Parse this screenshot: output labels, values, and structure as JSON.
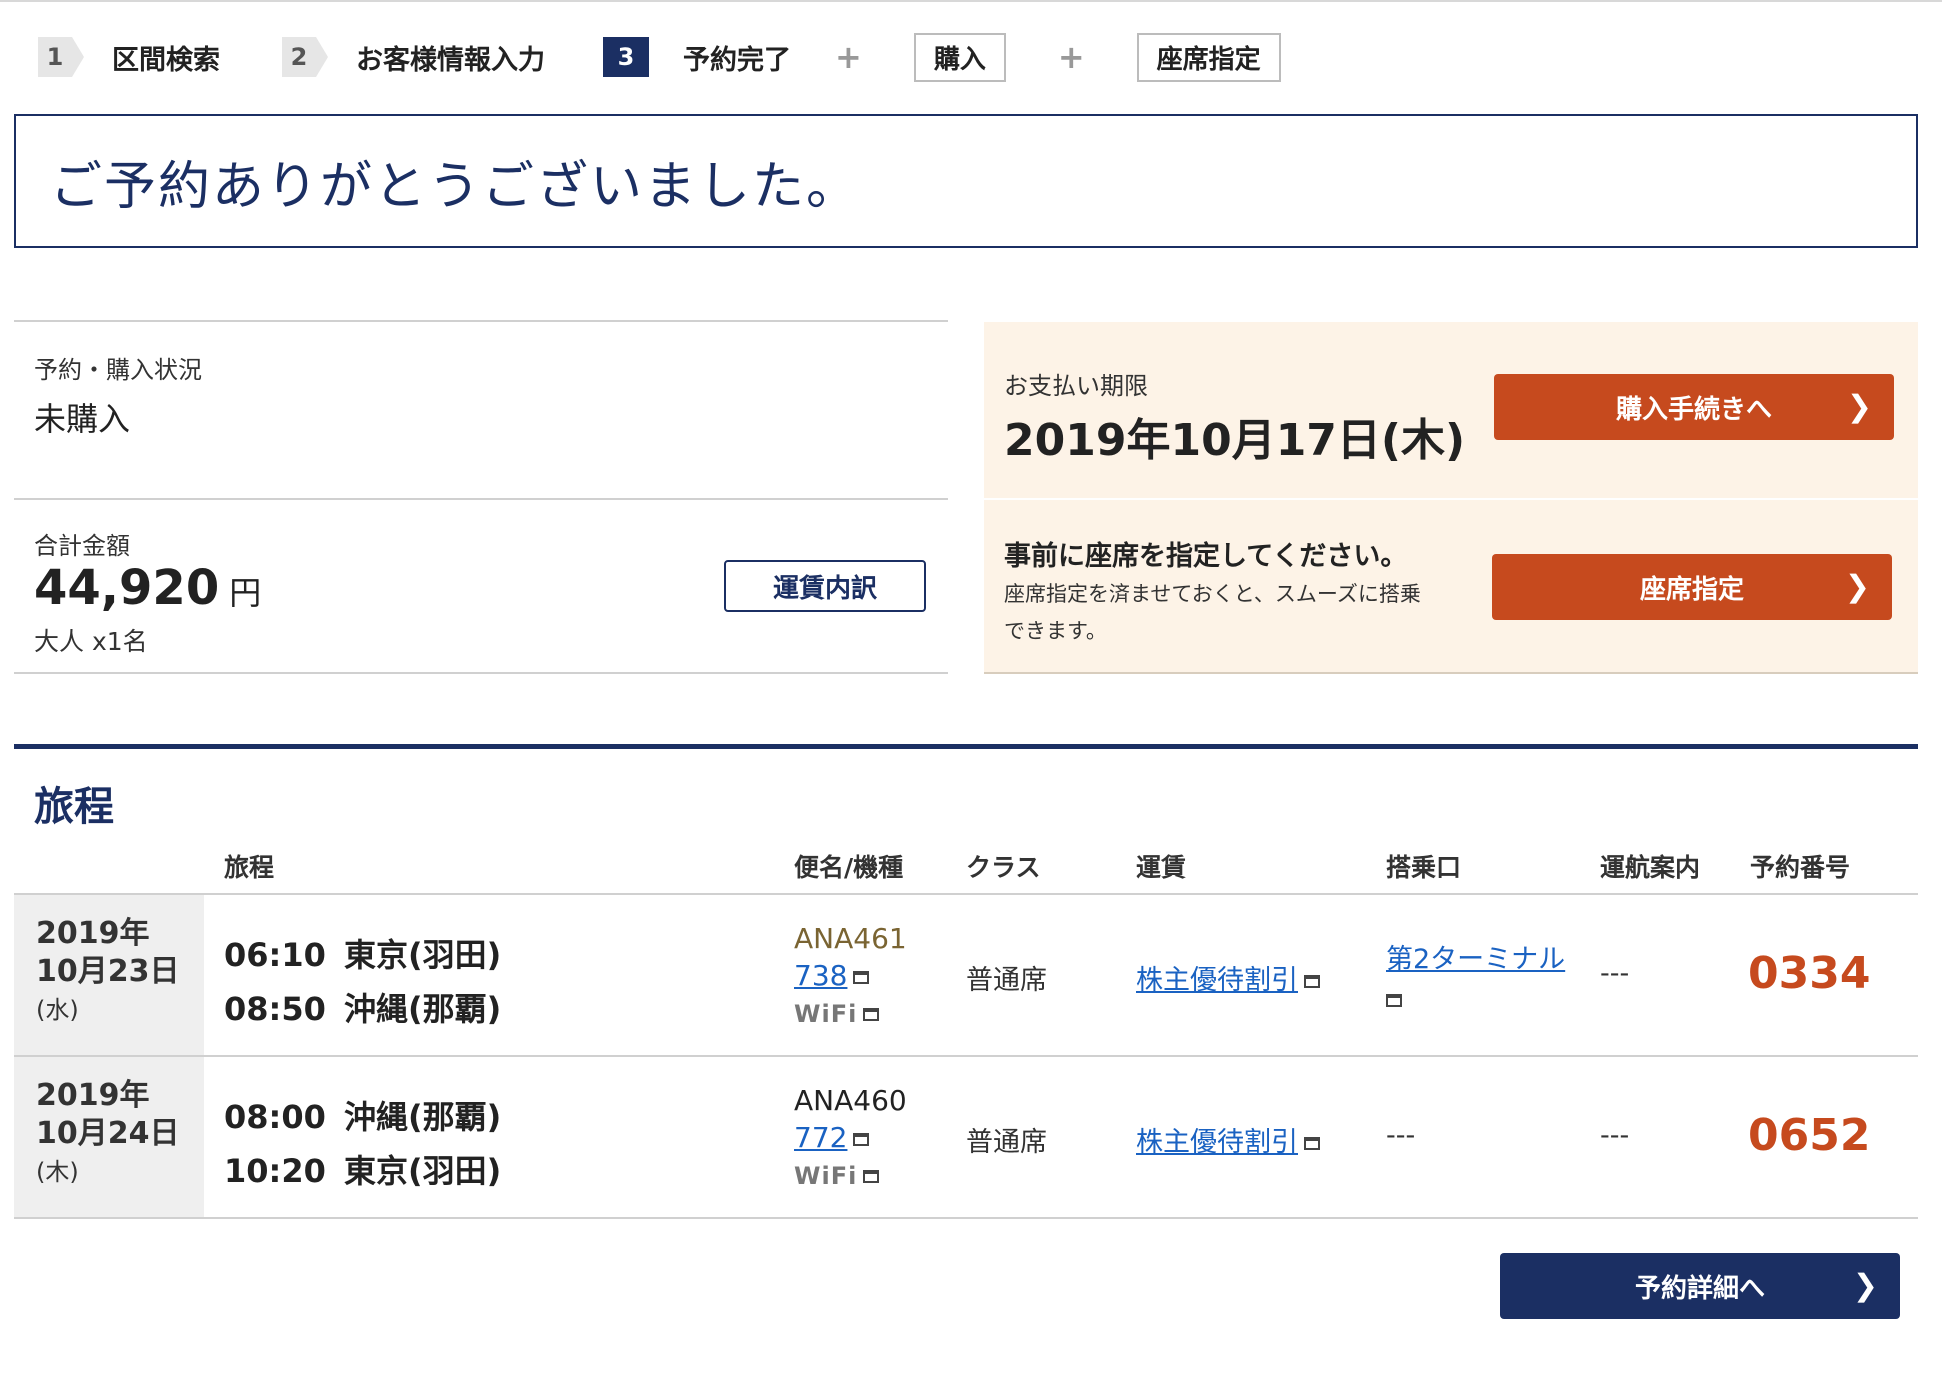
{
  "steps": [
    {
      "num": "1",
      "label": "区間検索"
    },
    {
      "num": "2",
      "label": "お客様情報入力"
    },
    {
      "num": "3",
      "label": "予約完了"
    }
  ],
  "plus": "+",
  "optional_steps": [
    "購入",
    "座席指定"
  ],
  "thanks": "ご予約ありがとうございました。",
  "status": {
    "label": "予約・購入状況",
    "value": "未購入"
  },
  "total": {
    "label": "合計金額",
    "amount": "44,920",
    "unit": "円",
    "pax": "大人 x1名",
    "fare_button": "運賃内訳"
  },
  "payment": {
    "label": "お支払い期限",
    "deadline": "2019年10月17日(木)",
    "button": "購入手続きへ"
  },
  "seat": {
    "title": "事前に座席を指定してください。",
    "desc": "座席指定を済ませておくと、スムーズに搭乗できます。",
    "button": "座席指定"
  },
  "itinerary": {
    "title": "旅程",
    "headers": {
      "route": "旅程",
      "flight": "便名/機種",
      "class": "クラス",
      "fare": "運賃",
      "gate": "搭乗口",
      "ops": "運航案内",
      "resno": "予約番号"
    },
    "rows": [
      {
        "year": "2019年",
        "date": "10月23日",
        "weekday": "(水)",
        "dep_time": "06:10",
        "dep": "東京(羽田)",
        "arr_time": "08:50",
        "arr": "沖縄(那覇)",
        "flight": "ANA461",
        "aircraft": "738",
        "wifi": "WiFi",
        "class": "普通席",
        "fare": "株主優待割引",
        "gate": "第2ターミナル",
        "ops": "---",
        "resno": "0334"
      },
      {
        "year": "2019年",
        "date": "10月24日",
        "weekday": "(木)",
        "dep_time": "08:00",
        "dep": "沖縄(那覇)",
        "arr_time": "10:20",
        "arr": "東京(羽田)",
        "flight": "ANA460",
        "aircraft": "772",
        "wifi": "WiFi",
        "class": "普通席",
        "fare": "株主優待割引",
        "gate": "---",
        "ops": "---",
        "resno": "0652"
      }
    ]
  },
  "detail_button": "予約詳細へ",
  "colors": {
    "navy": "#1b2f63",
    "orange": "#c64a1e",
    "cream": "#fdf3e7"
  }
}
